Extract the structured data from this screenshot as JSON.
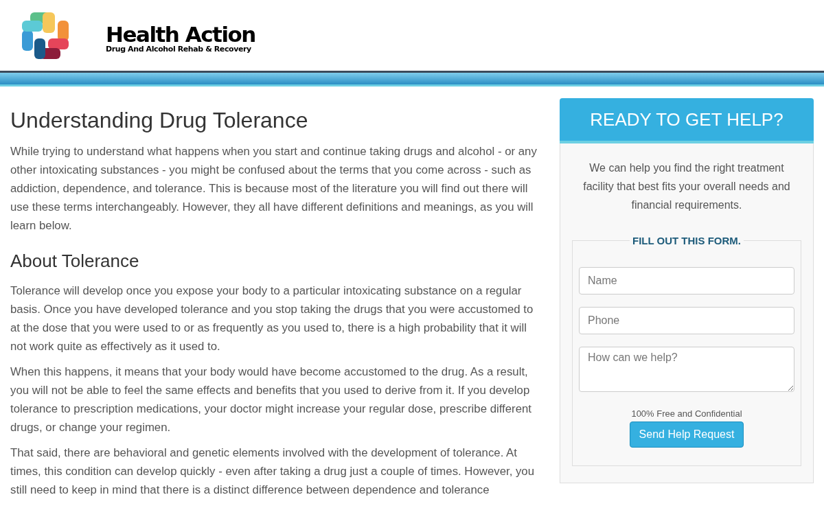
{
  "header": {
    "logo_title": "Health Action",
    "logo_subtitle": "Drug And Alcohol Rehab & Recovery"
  },
  "article": {
    "title": "Understanding Drug Tolerance",
    "blocks": [
      {
        "kind": "paragraph",
        "text": "While trying to understand what happens when you start and continue taking drugs and alcohol - or any other intoxicating substances - you might be confused about the terms that you come across - such as addiction, dependence, and tolerance. This is because most of the literature you will find out there will use these terms interchangeably. However, they all have different definitions and meanings, as you will learn below."
      },
      {
        "kind": "heading",
        "text": "About Tolerance"
      },
      {
        "kind": "paragraph",
        "text": "Tolerance will develop once you expose your body to a particular intoxicating substance on a regular basis. Once you have developed tolerance and you stop taking the drugs that you were accustomed to at the dose that you were used to or as frequently as you used to, there is a high probability that it will not work quite as effectively as it used to."
      },
      {
        "kind": "paragraph",
        "text": "When this happens, it means that your body would have become accustomed to the drug. As a result, you will not be able to feel the same effects and benefits that you used to derive from it. If you develop tolerance to prescription medications, your doctor might increase your regular dose, prescribe different drugs, or change your regimen."
      },
      {
        "kind": "paragraph",
        "text": "That said, there are behavioral and genetic elements involved with the development of tolerance. At times, this condition can develop quickly - even after taking a drug just a couple of times. However, you still need to keep in mind that there is a distinct difference between dependence and tolerance"
      }
    ]
  },
  "sidebar": {
    "title": "READY TO GET HELP?",
    "intro": "We can help you find the right treatment facility that best fits your overall needs and financial requirements.",
    "form": {
      "legend": "FILL OUT THIS FORM.",
      "fields": [
        {
          "kind": "input",
          "placeholder": "Name"
        },
        {
          "kind": "input",
          "placeholder": "Phone"
        },
        {
          "kind": "textarea",
          "placeholder": "How can we help?"
        }
      ],
      "note": "100% Free and Confidential",
      "button": "Send Help Request"
    }
  }
}
